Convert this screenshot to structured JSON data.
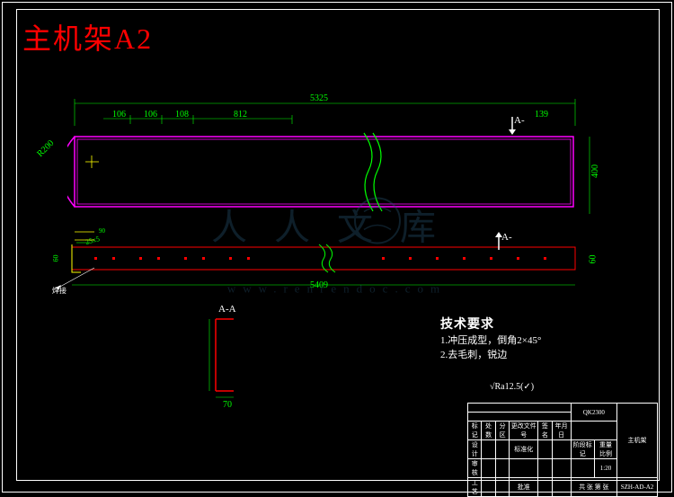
{
  "title": "主机架A2",
  "dimensions": {
    "main_length": "5325",
    "main_height": "400",
    "side_height": "60",
    "bottom_width": "5409",
    "small_dim1": "106",
    "small_dim2": "106",
    "small_dim3": "108",
    "small_dim4": "812",
    "angle": "R200",
    "section_width": "70",
    "edge_dim": "139",
    "flange": "25x5"
  },
  "section_labels": {
    "a": "A",
    "a_minus": "A-",
    "section_aa": "A-A"
  },
  "notes": {
    "title": "技术要求",
    "line1": "1.冲压成型，倒角2×45°",
    "line2": "2.去毛刺，锐边"
  },
  "surface_symbol": "√Ra12.5(✓)",
  "watermark": {
    "text": "人人文库",
    "url": "www.renrendoc.com"
  },
  "title_block": {
    "r1c1": "标记",
    "r1c2": "处数",
    "r1c3": "分区",
    "r1c4": "更改文件号",
    "r1c5": "签名",
    "r1c6": "年月日",
    "r2c1": "设计",
    "r2c2": "标准化",
    "r3c1": "审核",
    "r4c1": "工艺",
    "r4c2": "批准",
    "proj_label": "QK2300",
    "part_name": "主机架",
    "dwg_no": "SZH-AD-A2",
    "stage": "阶段标记",
    "weight": "重量",
    "scale": "比例",
    "scale_val": "1:20",
    "sheet": "共 张 第 张"
  }
}
